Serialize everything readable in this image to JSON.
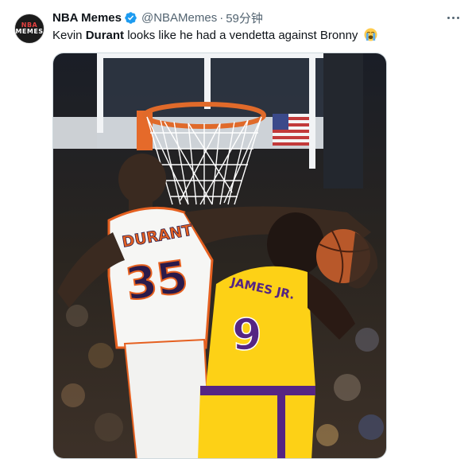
{
  "tweet": {
    "display_name": "NBA Memes",
    "handle": "@NBAMemes",
    "separator": "·",
    "time": "59分钟",
    "text_before": "Kevin ",
    "text_bold": "Durant",
    "text_after": " looks like he had a vendetta against Bronny",
    "avatar_line1": "NBA",
    "avatar_line2": "MEMES"
  },
  "media": {
    "jersey_left_name": "DURANT",
    "jersey_left_number": "35",
    "jersey_right_name": "JAMES JR.",
    "jersey_right_number": "9"
  },
  "colors": {
    "verified": "#1d9bf0",
    "secondary_text": "#536471",
    "suns_trim": "#e56020",
    "lakers_gold": "#fdd116",
    "lakers_purple": "#552583"
  },
  "icons": {
    "verified": "verified-badge-icon",
    "more": "more-dots-icon",
    "emoji": "loudly-crying-face-icon"
  }
}
